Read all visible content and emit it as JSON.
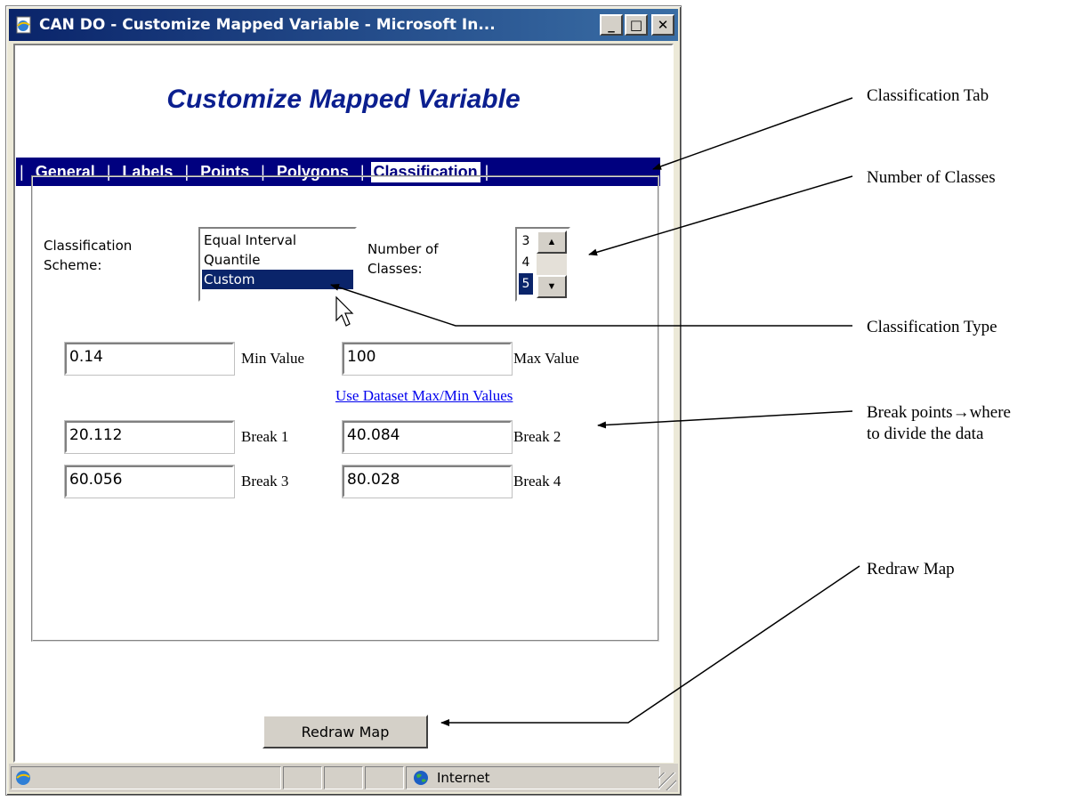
{
  "window": {
    "title": "CAN DO - Customize Mapped Variable - Microsoft In...",
    "minimize_glyph": "_",
    "maximize_glyph": "□",
    "close_glyph": "✕"
  },
  "page": {
    "title": "Customize Mapped Variable"
  },
  "tabs": {
    "separator": "|",
    "items": [
      {
        "label": "General",
        "active": false
      },
      {
        "label": "Labels",
        "active": false
      },
      {
        "label": "Points",
        "active": false
      },
      {
        "label": "Polygons",
        "active": false
      },
      {
        "label": "Classification",
        "active": true
      }
    ]
  },
  "classification": {
    "scheme_label": "Classification\nScheme:",
    "scheme_options": [
      "Equal Interval",
      "Quantile",
      "Custom"
    ],
    "scheme_selected": "Custom",
    "classes_label": "Number of\nClasses:",
    "classes_options": [
      "3",
      "4",
      "5"
    ],
    "classes_selected": "5"
  },
  "values": {
    "min_value": "0.14",
    "min_label": "Min Value",
    "max_value": "100",
    "max_label": "Max Value",
    "dataset_link": "Use Dataset Max/Min Values",
    "break1_value": "20.112",
    "break1_label": "Break 1",
    "break2_value": "40.084",
    "break2_label": "Break 2",
    "break3_value": "60.056",
    "break3_label": "Break 3",
    "break4_value": "80.028",
    "break4_label": "Break 4"
  },
  "redraw_button": "Redraw Map",
  "status": {
    "zone": "Internet"
  },
  "annotations": {
    "classification_tab": "Classification Tab",
    "number_of_classes": "Number of Classes",
    "classification_type": "Classification Type",
    "break_points_line1": "Break points→where",
    "break_points_line2": "to divide the data",
    "redraw_map": "Redraw Map"
  },
  "colors": {
    "title_blue": "#0b1f8f",
    "tab_bar": "#00007f",
    "selection": "#0a246a",
    "link": "#0000ee"
  }
}
